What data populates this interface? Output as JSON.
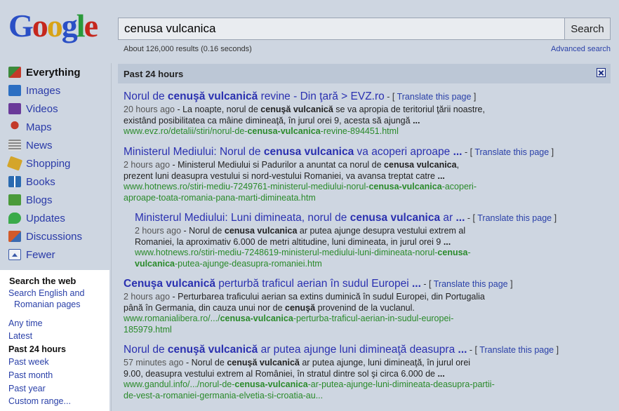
{
  "logo": {
    "letters": [
      "G",
      "o",
      "o",
      "g",
      "l",
      "e"
    ]
  },
  "search": {
    "value": "cenusa vulcanica",
    "button": "Search"
  },
  "stats": "About 126,000 results (0.16 seconds)",
  "advanced": "Advanced search",
  "nav": [
    {
      "label": "Everything",
      "icon": "everything-icon",
      "color": "#3b8a3b"
    },
    {
      "label": "Images",
      "icon": "images-icon",
      "color": "#2c6fc2"
    },
    {
      "label": "Videos",
      "icon": "videos-icon",
      "color": "#6a3a9a"
    },
    {
      "label": "Maps",
      "icon": "maps-icon",
      "color": "#c33a2a"
    },
    {
      "label": "News",
      "icon": "news-icon",
      "color": "#888888"
    },
    {
      "label": "Shopping",
      "icon": "shopping-icon",
      "color": "#d4a52a"
    },
    {
      "label": "Books",
      "icon": "books-icon",
      "color": "#2a6ab0"
    },
    {
      "label": "Blogs",
      "icon": "blogs-icon",
      "color": "#4a9a3a"
    },
    {
      "label": "Updates",
      "icon": "updates-icon",
      "color": "#3aaa4a"
    },
    {
      "label": "Discussions",
      "icon": "discussions-icon",
      "color": "#d25a2a"
    },
    {
      "label": "Fewer",
      "icon": "fewer-icon",
      "color": "#3a5aa8"
    }
  ],
  "tools": {
    "heading": "Search the web",
    "lang_line1": "Search English and",
    "lang_line2": "Romanian pages",
    "times": [
      "Any time",
      "Latest",
      "Past 24 hours",
      "Past week",
      "Past month",
      "Past year",
      "Custom range..."
    ]
  },
  "time_bar": "Past 24 hours",
  "translate": {
    "prefix": "- [ ",
    "link": "Translate this page",
    "suffix": " ]"
  },
  "results": [
    {
      "t": [
        "Norul de ",
        "cenuşă vulcanică",
        " revine - Din ţară > EVZ.ro"
      ],
      "date": "20 hours ago",
      "s1": [
        " - La noapte, norul de ",
        "cenuşă vulcanică",
        " se va apropia de teritoriul ţării noastre,"
      ],
      "s2": [
        "existând posibilitatea ca mâine dimineaţă, în jurul orei 9, acesta să ajungă ",
        "...",
        ""
      ],
      "u1": [
        "www.evz.ro/detalii/stiri/norul-de-",
        "cenusa-vulcanica",
        "-revine-894451.html"
      ],
      "u2": [
        "",
        "",
        ""
      ]
    },
    {
      "t": [
        "Ministerul Mediului: Norul de ",
        "cenusa vulcanica",
        " va acoperi aproape ",
        "..."
      ],
      "date": "2 hours ago",
      "s1": [
        " - Ministerul Mediului si Padurilor a anuntat ca norul de ",
        "cenusa vulcanica",
        ","
      ],
      "s2": [
        "prezent luni deasupra vestului si nord-vestului Romaniei, va avansa treptat catre ",
        "...",
        ""
      ],
      "u1": [
        "www.hotnews.ro/stiri-mediu-7249761-ministerul-mediului-norul-",
        "cenusa-vulcanica",
        "-acoperi-"
      ],
      "u2": [
        "aproape-toata-romania-pana-marti-dimineata.htm",
        "",
        ""
      ]
    },
    {
      "t": [
        "Ministerul Mediului: Luni dimineata, norul de ",
        "cenusa vulcanica",
        " ar ",
        "..."
      ],
      "date": "2 hours ago",
      "s1": [
        " - Norul de ",
        "cenusa vulcanica",
        " ar putea ajunge desupra vestului extrem al"
      ],
      "s2": [
        "Romaniei, la aproximativ 6.000 de metri altitudine, luni dimineata, in jurul orei 9 ",
        "...",
        ""
      ],
      "u1": [
        "www.hotnews.ro/stiri-mediu-7248619-ministerul-mediului-luni-dimineata-norul-",
        "cenusa",
        "-"
      ],
      "u2": [
        "",
        "vulcanica",
        "-putea-ajunge-deasupra-romaniei.htm"
      ]
    },
    {
      "t": [
        "Cenuşa vulcanică",
        " perturbă traficul aerian în sudul Europei ",
        "..."
      ],
      "date": "2 hours ago",
      "s1": [
        " - Perturbarea traficului aerian sa extins duminică în sudul Europei, din Portugalia",
        "",
        ""
      ],
      "s2": [
        "până în Germania, din cauza unui nor de ",
        "cenuşă",
        " provenind de la vuclanul."
      ],
      "u1": [
        "www.romanialibera.ro/.../",
        "cenusa-vulcanica",
        "-perturba-traficul-aerian-in-sudul-europei-"
      ],
      "u2": [
        "185979.html",
        "",
        ""
      ]
    },
    {
      "t": [
        "Norul de ",
        "cenuşă vulcanică",
        " ar putea ajunge luni dimineaţă deasupra ",
        "..."
      ],
      "date": "57 minutes ago",
      "s1": [
        " - Norul de ",
        "cenuşă vulcanică",
        " ar putea ajunge, luni dimineaţă, în jurul orei"
      ],
      "s2": [
        "9.00, deasupra vestului extrem al României, în stratul dintre sol şi circa 6.000 de ",
        "...",
        ""
      ],
      "u1": [
        "www.gandul.info/.../norul-de-",
        "cenusa-vulcanica",
        "-ar-putea-ajunge-luni-dimineata-deasupra-partii-"
      ],
      "u2": [
        "de-vest-a-romaniei-germania-elvetia-si-croatia-au...",
        "",
        ""
      ]
    }
  ]
}
